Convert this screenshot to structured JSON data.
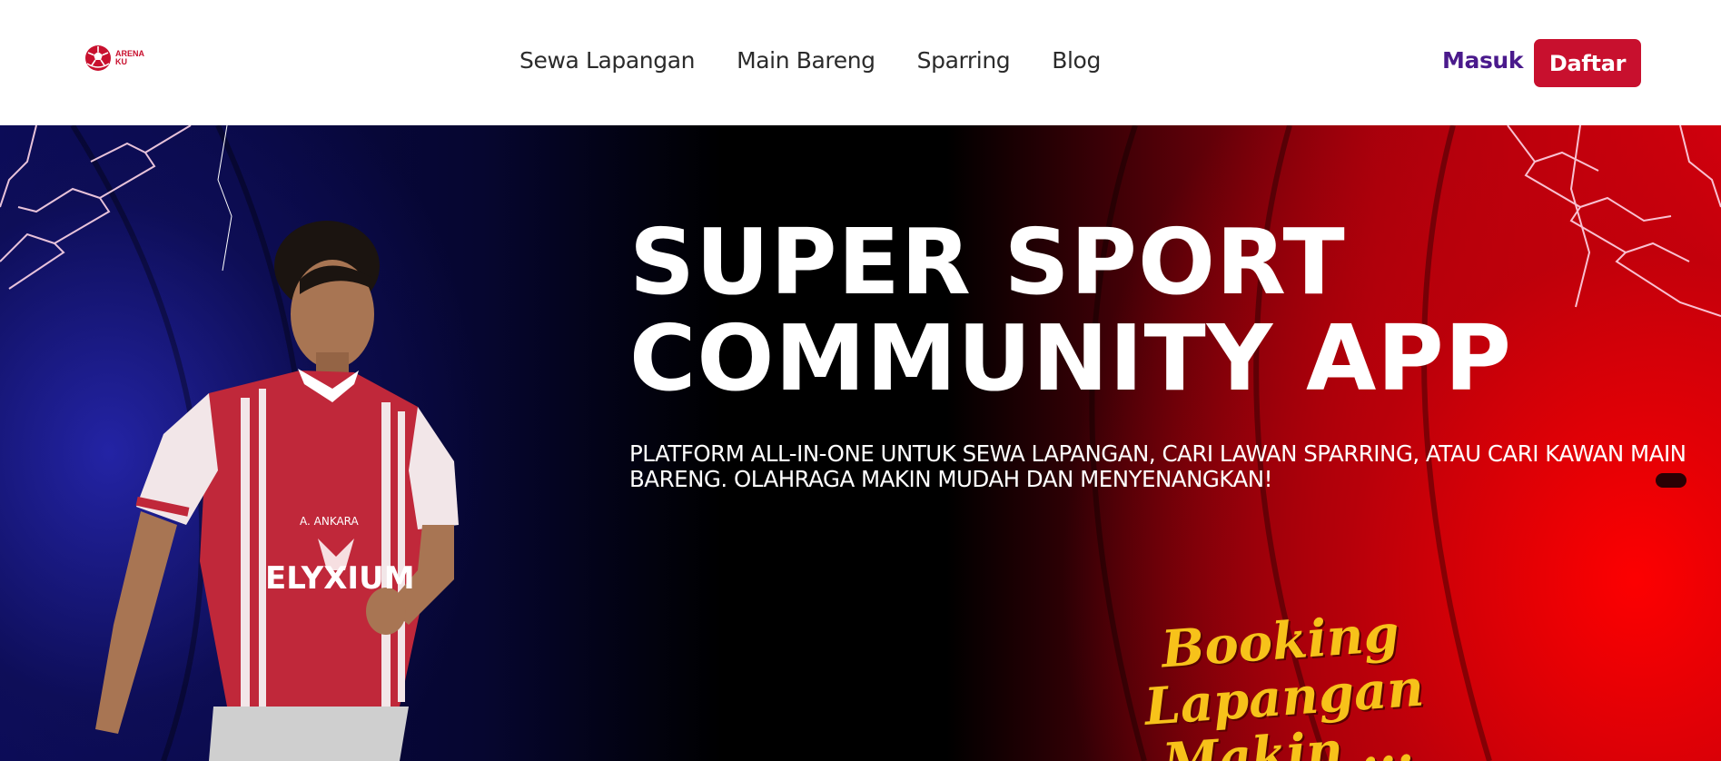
{
  "brand": {
    "line1": "ARENA",
    "line2": "KU"
  },
  "nav": {
    "links": [
      {
        "label": "Sewa Lapangan"
      },
      {
        "label": "Main Bareng"
      },
      {
        "label": "Sparring"
      },
      {
        "label": "Blog"
      }
    ],
    "login_label": "Masuk",
    "register_label": "Daftar"
  },
  "hero": {
    "title": "SUPER SPORT\nCOMMUNITY APP",
    "subtitle": "PLATFORM ALL-IN-ONE UNTUK SEWA LAPANGAN, CARI LAWAN SPARRING, ATAU CARI KAWAN MAIN BARENG. OLAHRAGA MAKIN MUDAH DAN MENYENANGKAN!",
    "promo": "Booking Lapangan Makin ..."
  },
  "colors": {
    "brand_red": "#c8102e",
    "login_purple": "#4a1a8c",
    "promo_yellow": "#f7c21a"
  },
  "icons": {
    "logo": "soccer-ball-icon"
  }
}
